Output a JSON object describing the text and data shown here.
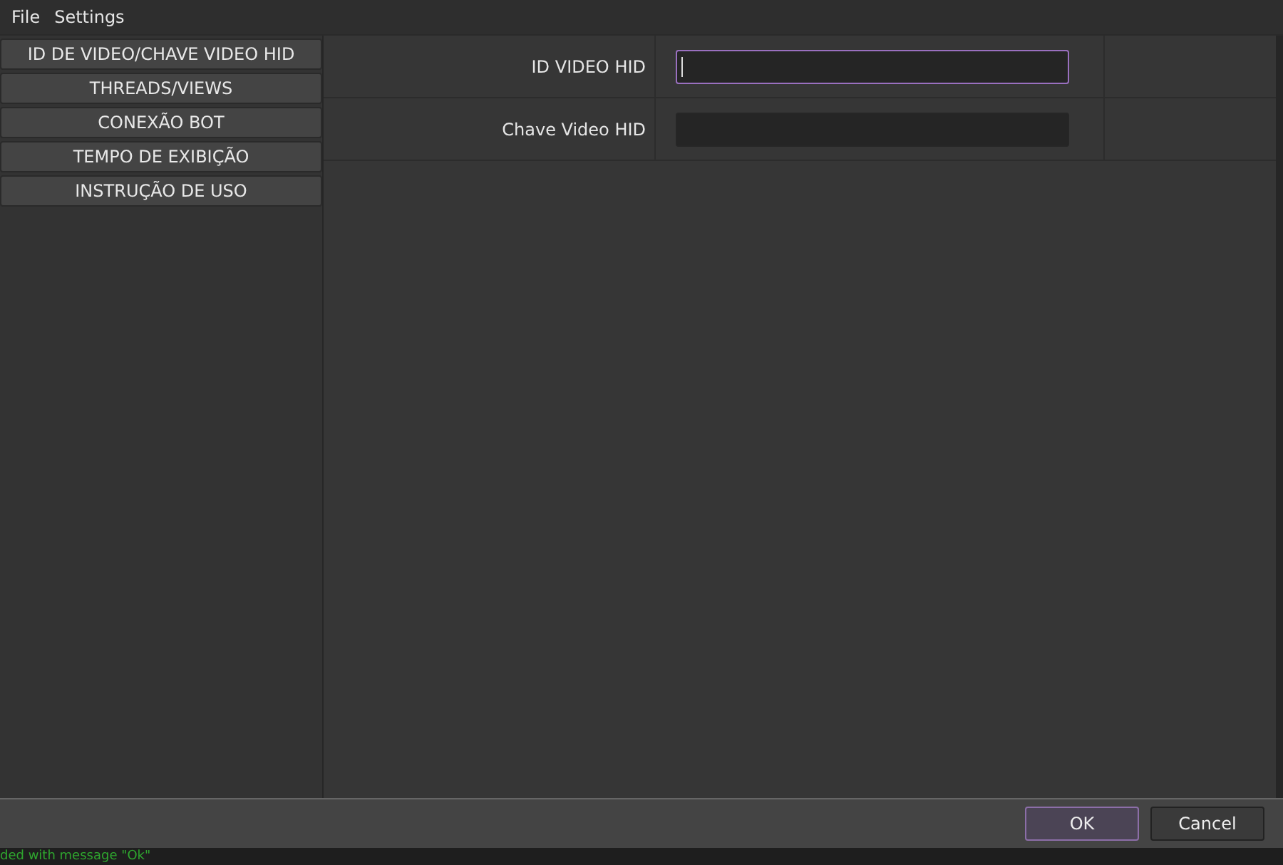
{
  "menu": [
    "File",
    "Settings"
  ],
  "sidebar": {
    "items": [
      {
        "label": "ID DE VIDEO/CHAVE VIDEO HID"
      },
      {
        "label": "THREADS/VIEWS"
      },
      {
        "label": "CONEXÃO BOT"
      },
      {
        "label": "TEMPO DE EXIBIÇÃO"
      },
      {
        "label": "INSTRUÇÃO DE USO"
      }
    ]
  },
  "form": {
    "fields": [
      {
        "label": "ID VIDEO HID",
        "focused": true
      },
      {
        "label": "Chave Video HID",
        "focused": false
      }
    ]
  },
  "buttons": [
    {
      "label": "OK",
      "default": true
    },
    {
      "label": "Cancel",
      "default": false
    }
  ],
  "console": "ded with message \"Ok\""
}
